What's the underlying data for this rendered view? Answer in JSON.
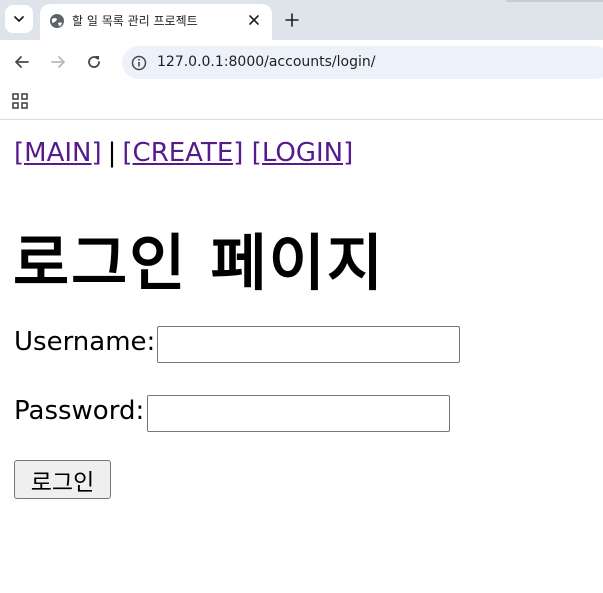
{
  "browser": {
    "tab": {
      "title": "할 일 목록 관리 프로젝트"
    },
    "address_bar": {
      "url": "127.0.0.1:8000/accounts/login/"
    },
    "icons": {
      "tab_search": "chevron-down-icon",
      "favicon": "globe-icon",
      "tab_close": "close-icon",
      "new_tab": "plus-icon",
      "back": "arrow-left-icon",
      "forward": "arrow-right-icon",
      "reload": "reload-icon",
      "site_info": "info-icon",
      "apps": "apps-grid-icon"
    }
  },
  "page": {
    "nav": {
      "main": "[MAIN]",
      "separator": "|",
      "create": "[CREATE]",
      "login": "[LOGIN]"
    },
    "heading": "로그인 페이지",
    "form": {
      "username_label": "Username:",
      "username_value": "",
      "password_label": "Password:",
      "password_value": "",
      "submit_label": "로그인"
    }
  },
  "colors": {
    "tabstrip_bg": "#dfe3ea",
    "omnibox_bg": "#edf2fa",
    "visited_link": "#551a8b"
  }
}
